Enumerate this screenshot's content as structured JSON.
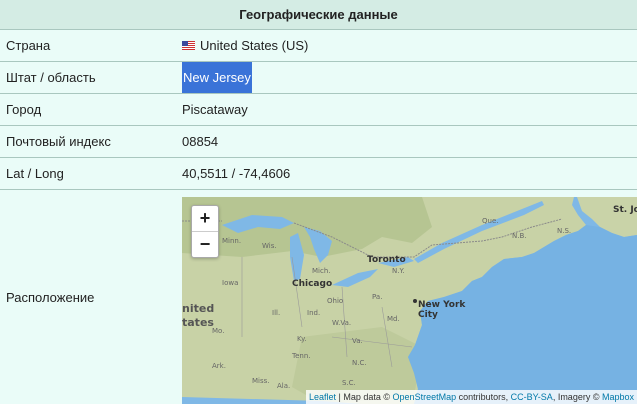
{
  "header": {
    "title": "Географические данные"
  },
  "rows": {
    "country": {
      "label": "Страна",
      "value": "United States (US)",
      "flag_icon": "us-flag-icon"
    },
    "state": {
      "label": "Штат / область",
      "value": "New Jersey"
    },
    "city": {
      "label": "Город",
      "value": "Piscataway"
    },
    "zip": {
      "label": "Почтовый индекс",
      "value": "08854"
    },
    "latlong": {
      "label": "Lat / Long",
      "value": "40,5511 / -74,4606"
    },
    "location": {
      "label": "Расположение"
    }
  },
  "map": {
    "zoom_in": "+",
    "zoom_out": "−",
    "labels": {
      "chicago": "Chicago",
      "toronto": "Toronto",
      "new_york": "New York",
      "new_york_2": "City",
      "united": "nited",
      "states": "tates",
      "st_j": "St. Jo",
      "ny": "N.Y.",
      "iowa": "Iowa",
      "ohio": "Ohio",
      "ill": "Ill.",
      "ind": "Ind.",
      "ky": "Ky.",
      "tenn": "Tenn.",
      "va": "Va.",
      "nc": "N.C.",
      "pa": "Pa.",
      "miss": "Miss.",
      "ala": "Ala.",
      "wis": "Wis.",
      "mich": "Mich.",
      "minn": "Minn.",
      "qc": "Que.",
      "nb": "N.B.",
      "ns": "N.S.",
      "mo": "Mo.",
      "ark": "Ark.",
      "wva": "W.Va.",
      "sc": "S.C.",
      "md": "Md."
    },
    "attribution": {
      "leaflet": "Leaflet",
      "sep": " | Map data © ",
      "osm": "OpenStreetMap",
      "contrib": " contributors, ",
      "ccbysa": "CC-BY-SA",
      "imagery": ", Imagery © ",
      "mapbox": "Mapbox"
    }
  },
  "colors": {
    "background": "#eafcf8",
    "header_bg": "#d4ece4",
    "border": "#a9c7bf",
    "selection": "#3a73d8",
    "water": "#7fb8e6",
    "link": "#0078a8"
  }
}
